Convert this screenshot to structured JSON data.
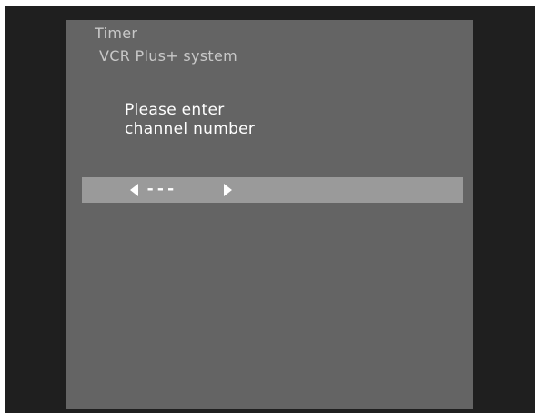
{
  "menu": {
    "title": "Timer",
    "subtitle": "VCR Plus+ system"
  },
  "prompt": {
    "line1": "Please enter",
    "line2": "channel number"
  },
  "entry": {
    "channel_value": "---",
    "left_icon": "arrow-left-icon",
    "right_icon": "arrow-right-icon"
  },
  "colors": {
    "background": "#1f1f1f",
    "panel": "#646464",
    "highlight_bar": "#9a9a9a",
    "text": "#ffffff",
    "header_text": "#c8c8c8"
  }
}
